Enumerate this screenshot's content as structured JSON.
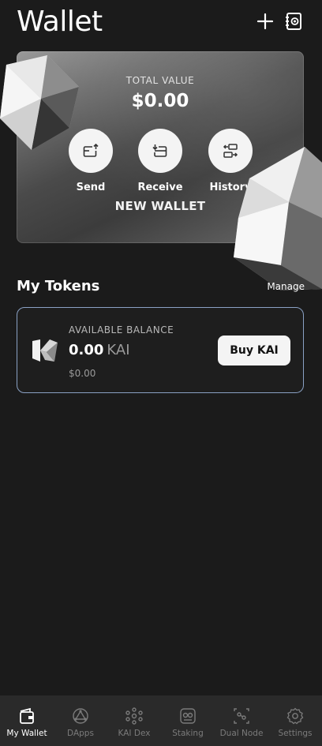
{
  "header": {
    "title": "Wallet",
    "add_icon": "plus-icon",
    "address_book_icon": "address-book-icon"
  },
  "wallet_card": {
    "total_label": "TOTAL VALUE",
    "total_value": "$0.00",
    "actions": [
      {
        "label": "Send",
        "icon": "send-icon"
      },
      {
        "label": "Receive",
        "icon": "receive-icon"
      },
      {
        "label": "History",
        "icon": "history-icon"
      }
    ],
    "wallet_name": "NEW WALLET"
  },
  "tokens": {
    "title": "My Tokens",
    "manage_label": "Manage"
  },
  "token_card": {
    "available_label": "AVAILABLE BALANCE",
    "amount": "0.00",
    "symbol": "KAI",
    "usd_value": "$0.00",
    "buy_label": "Buy KAI",
    "logo_icon": "kardiachain-logo-icon"
  },
  "bottom_nav": {
    "items": [
      {
        "label": "My Wallet",
        "icon": "wallet-icon",
        "active": true
      },
      {
        "label": "DApps",
        "icon": "dapps-icon",
        "active": false
      },
      {
        "label": "KAI Dex",
        "icon": "dex-icon",
        "active": false
      },
      {
        "label": "Staking",
        "icon": "staking-icon",
        "active": false
      },
      {
        "label": "Dual Node",
        "icon": "dual-node-icon",
        "active": false
      },
      {
        "label": "Settings",
        "icon": "gear-icon",
        "active": false
      }
    ]
  },
  "colors": {
    "background": "#1b1b1b",
    "card_border": "#8aa1c4",
    "nav_background": "#2a2a2a",
    "nav_inactive": "#7b7b7b"
  }
}
